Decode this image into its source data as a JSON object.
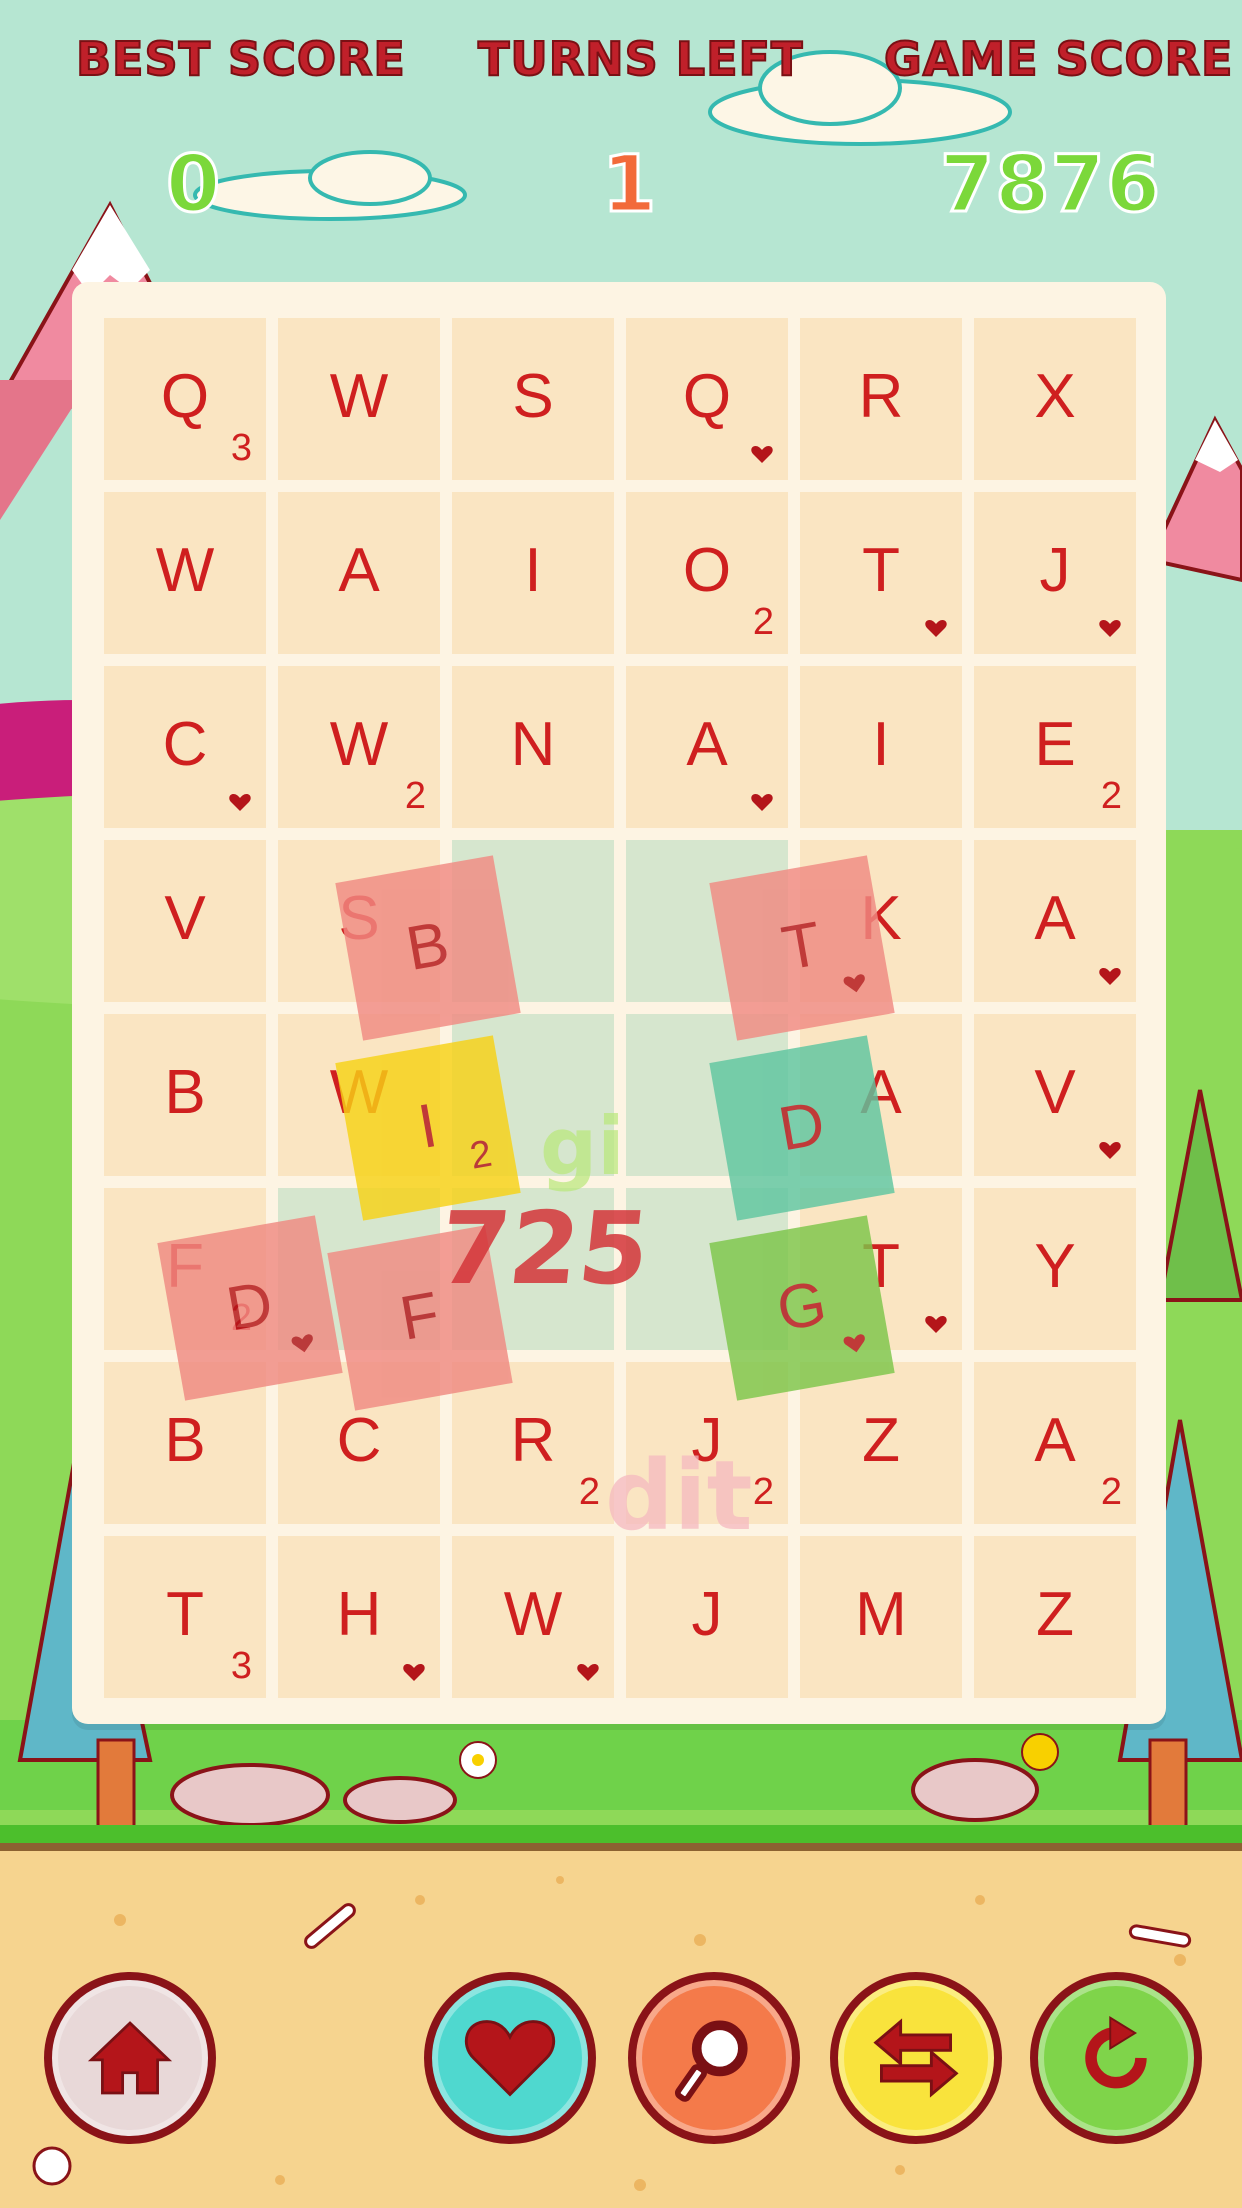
{
  "hud": {
    "best_score_label": "BEST SCORE",
    "turns_left_label": "TURNS LEFT",
    "game_score_label": "GAME SCORE",
    "best_score": "0",
    "turns_left": "1",
    "game_score": "7876"
  },
  "board": {
    "rows": [
      [
        {
          "l": "Q",
          "m": "3"
        },
        {
          "l": "W"
        },
        {
          "l": "S"
        },
        {
          "l": "Q",
          "h": true
        },
        {
          "l": "R"
        },
        {
          "l": "X"
        }
      ],
      [
        {
          "l": "W"
        },
        {
          "l": "A"
        },
        {
          "l": "I"
        },
        {
          "l": "O",
          "m": "2"
        },
        {
          "l": "T",
          "h": true
        },
        {
          "l": "J",
          "h": true
        }
      ],
      [
        {
          "l": "C",
          "h": true
        },
        {
          "l": "W",
          "m": "2"
        },
        {
          "l": "N"
        },
        {
          "l": "A",
          "h": true
        },
        {
          "l": "I"
        },
        {
          "l": "E",
          "m": "2"
        }
      ],
      [
        {
          "l": "V"
        },
        {
          "l": "S"
        },
        {
          "l": ""
        },
        {
          "l": ""
        },
        {
          "l": "K"
        },
        {
          "l": "A",
          "h": true
        }
      ],
      [
        {
          "l": "B"
        },
        {
          "l": "W"
        },
        {
          "l": ""
        },
        {
          "l": ""
        },
        {
          "l": "A"
        },
        {
          "l": "V",
          "h": true
        }
      ],
      [
        {
          "l": "F",
          "m": "2"
        },
        {
          "l": ""
        },
        {
          "l": ""
        },
        {
          "l": ""
        },
        {
          "l": "T",
          "h": true
        },
        {
          "l": "Y"
        }
      ],
      [
        {
          "l": "B"
        },
        {
          "l": "C"
        },
        {
          "l": "R",
          "m": "2"
        },
        {
          "l": "J",
          "m": "2"
        },
        {
          "l": "Z"
        },
        {
          "l": "A",
          "m": "2"
        }
      ],
      [
        {
          "l": "T",
          "m": "3"
        },
        {
          "l": "H",
          "h": true
        },
        {
          "l": "W",
          "h": true
        },
        {
          "l": "J"
        },
        {
          "l": "M"
        },
        {
          "l": "Z"
        }
      ]
    ]
  },
  "floating_tiles": [
    {
      "letter": "B",
      "color": "#f08a82"
    },
    {
      "letter": "I",
      "mult": "2",
      "color": "#f7d216"
    },
    {
      "letter": "D",
      "heart": true,
      "color": "#f08a82"
    },
    {
      "letter": "F",
      "color": "#f08a82"
    },
    {
      "letter": "T",
      "heart": true,
      "color": "#f08a82"
    },
    {
      "letter": "D",
      "color": "#5fc6a0"
    },
    {
      "letter": "G",
      "heart": true,
      "color": "#7dc64a"
    }
  ],
  "popup": {
    "score": "725",
    "word_fragment_1": "gi",
    "word_fragment_2": "dit"
  },
  "buttons": [
    {
      "name": "home-button",
      "icon": "home-icon",
      "color": "#e8d8d8"
    },
    {
      "name": "heart-button",
      "icon": "heart-icon",
      "color": "#4fd8cf"
    },
    {
      "name": "hint-button",
      "icon": "magnifier-icon",
      "color": "#f47a4a"
    },
    {
      "name": "swap-button",
      "icon": "swap-arrows-icon",
      "color": "#f9e33c"
    },
    {
      "name": "refresh-button",
      "icon": "refresh-icon",
      "color": "#7fd44a"
    }
  ],
  "colors": {
    "tile": "#fae5c2",
    "letter": "#cf1f1f",
    "board": "#fdf4e3",
    "grass": "#6fd24a",
    "sand": "#f6d48f"
  }
}
